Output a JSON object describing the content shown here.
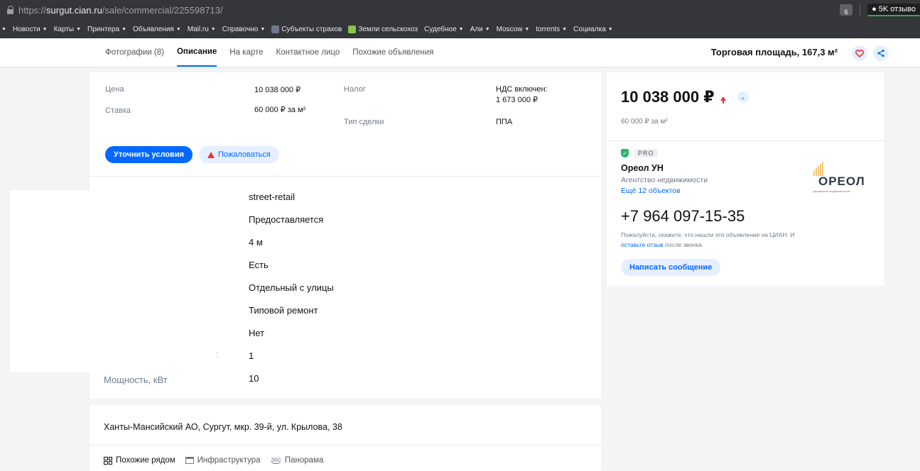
{
  "browser": {
    "url_prefix": "https://",
    "url_host": "surgut.cian.ru",
    "url_path": "/sale/commercial/225598713/",
    "ext_badge": "6",
    "reviews": "5K отзыво"
  },
  "bookmarks": [
    {
      "label": "Новости",
      "caret": true
    },
    {
      "label": "Карты",
      "caret": true
    },
    {
      "label": "Принтера",
      "caret": true
    },
    {
      "label": "Объявления",
      "caret": true
    },
    {
      "label": "Mail.ru",
      "caret": true
    },
    {
      "label": "Справочно",
      "caret": true
    },
    {
      "label": "Субъекты страхов",
      "caret": false,
      "fav": "#6e7a8a"
    },
    {
      "label": "Земли сельскохоз",
      "caret": false,
      "fav": "#8bc34a"
    },
    {
      "label": "Судебное",
      "caret": true
    },
    {
      "label": "Али",
      "caret": true
    },
    {
      "label": "Moscow",
      "caret": true
    },
    {
      "label": "torrents",
      "caret": true
    },
    {
      "label": "Социалка",
      "caret": true
    }
  ],
  "nav": {
    "tabs": [
      "Фотографии (8)",
      "Описание",
      "На карте",
      "Контактное лицо",
      "Похожие объявления"
    ],
    "active_index": 1,
    "title": "Торговая площадь, 167,3 м²"
  },
  "price_block": {
    "price_label": "Цена",
    "price_value": "10 038 000 ₽",
    "rate_label": "Ставка",
    "rate_value": "60 000 ₽ за м²",
    "tax_label": "Налог",
    "tax_value_1": "НДС включен:",
    "tax_value_2": "1 673 000 ₽",
    "deal_label": "Тип сделки",
    "deal_value": "ППА",
    "clarify_button": "Уточнить условия",
    "report_button": "Пожаловаться"
  },
  "attributes": [
    "street-retail",
    "Предоставляется",
    "4 м",
    "Есть",
    "Отдельный с улицы",
    "Типовой ремонт",
    "Нет",
    "1",
    "10"
  ],
  "power_label": "Мощность, кВт",
  "colon": ":",
  "location": {
    "address": "Ханты-Мансийский АО, Сургут, мкр. 39-й, ул. Крылова, 38",
    "links": [
      "Похожие рядом",
      "Инфраструктура",
      "Панорама"
    ],
    "pano_badge": "360"
  },
  "sidebar": {
    "price": "10 038 000 ₽",
    "per_m": "60 000 ₽ за м²",
    "pro": "PRO",
    "agent_name": "Ореол УН",
    "agent_type": "Агентство недвижимости",
    "agent_link": "Ещё 12 объектов",
    "logo_text": "ОРЕОЛ",
    "logo_sub": "управление недвижимостью",
    "phone": "+7 964 097-15-35",
    "note_1": "Пожалуйста, скажите, что нашли это объявление на ЦИАН. И ",
    "note_link": "оставьте отзыв",
    "note_2": " после звонка",
    "message_button": "Написать сообщение"
  },
  "colors": {
    "accent": "#0468ff",
    "danger": "#e5323f",
    "pro_green": "#2db56b"
  }
}
